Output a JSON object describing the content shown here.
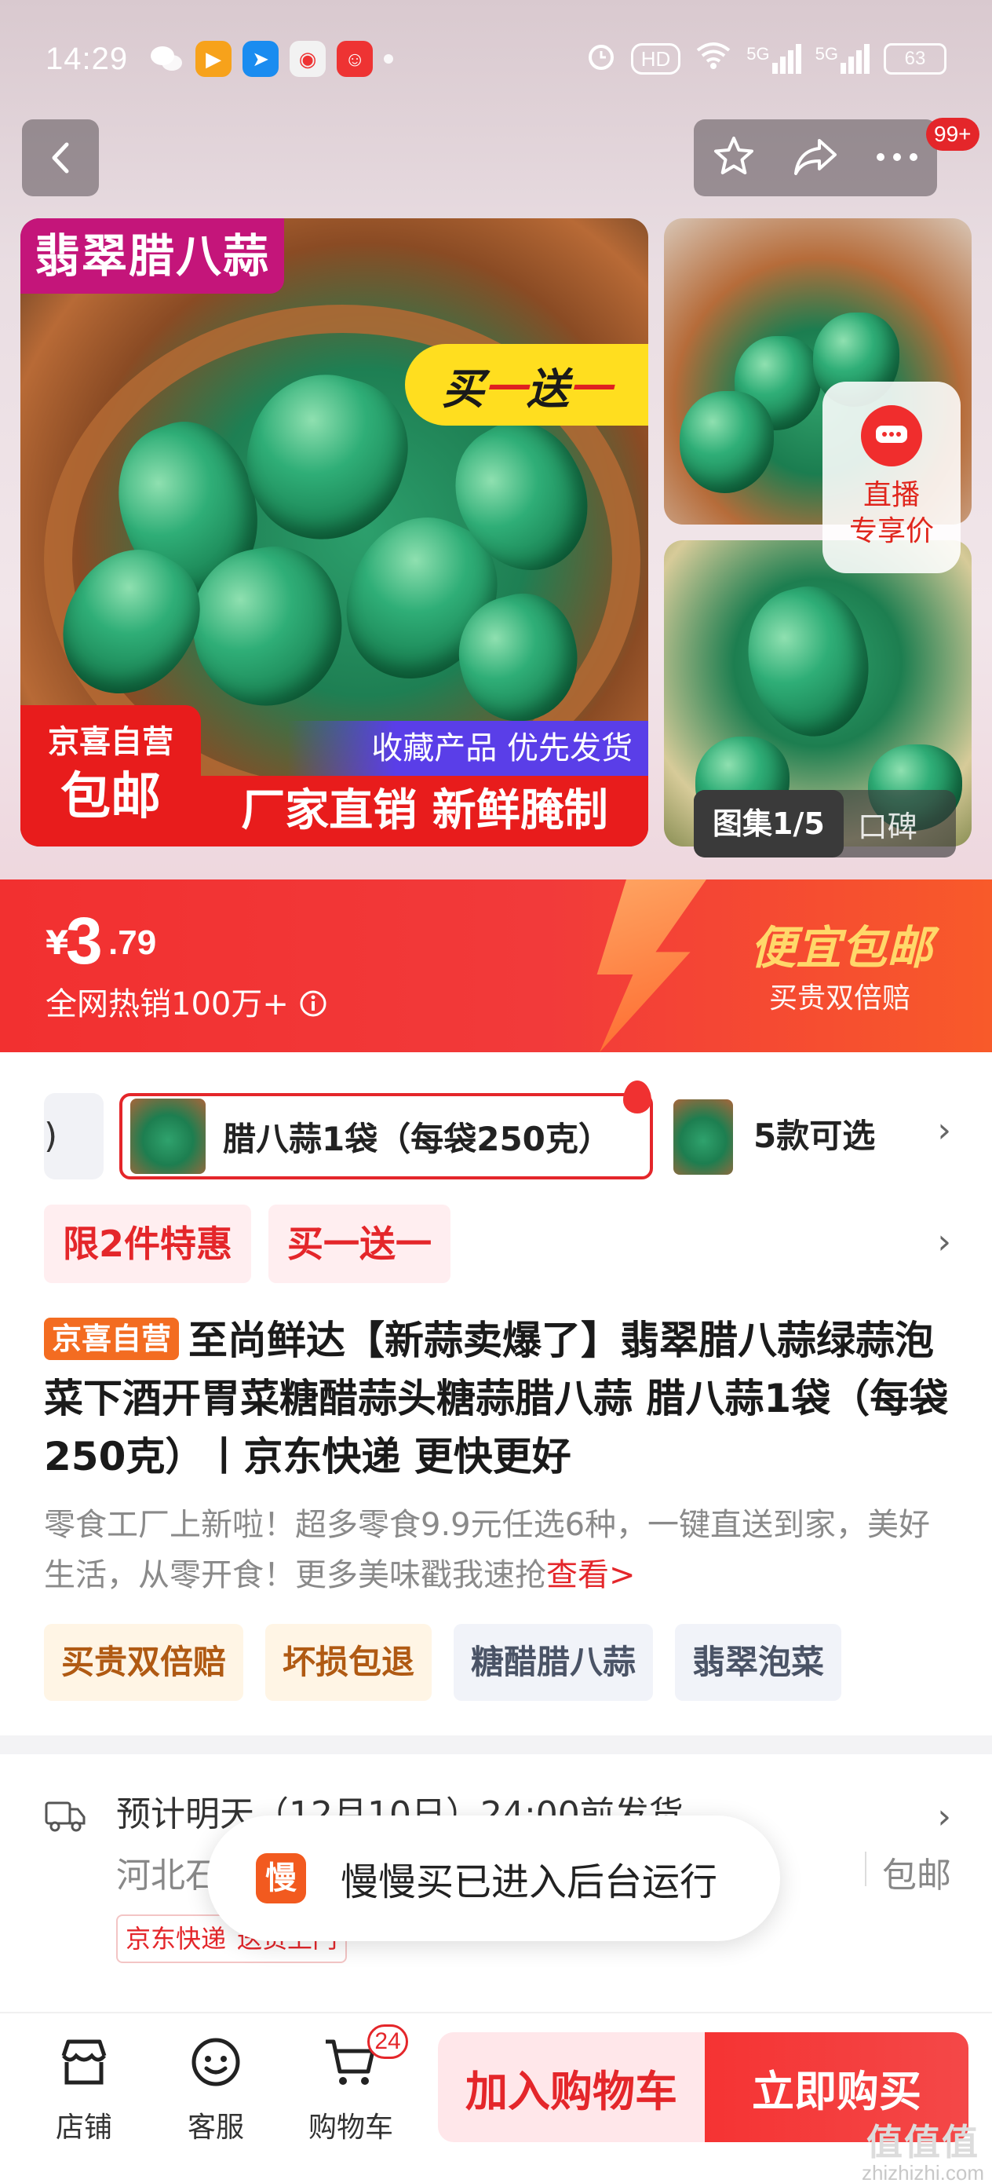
{
  "status_bar": {
    "time": "14:29",
    "hd_label": "HD",
    "signal_1": "5G",
    "signal_2": "5G",
    "battery": "63"
  },
  "nav": {
    "badge": "99+"
  },
  "gallery": {
    "main_title": "翡翠腊八蒜",
    "promo_left": "买",
    "promo_mid": "一",
    "promo_right": "送",
    "promo_end": "一",
    "fav_text": "收藏产品 优先发货",
    "bottom_text": "厂家直销 新鲜腌制",
    "self_badge_line1": "京喜自营",
    "self_badge_line2": "包邮",
    "live_line1": "直播",
    "live_line2": "专享价",
    "chip_active": "图集1/5",
    "chip_other": "口碑"
  },
  "price": {
    "currency": "¥",
    "integer": "3",
    "decimal": ".79",
    "hot_sales": "全网热销100万+",
    "cheap_label": "便宜包邮",
    "guarantee": "买贵双倍赔"
  },
  "variants": {
    "prev_fragment": ")",
    "selected_label": "腊八蒜1袋（每袋250克）",
    "count_label": "5款可选"
  },
  "promo_tags": [
    "限2件特惠",
    "买一送一"
  ],
  "product": {
    "self_tag": "京喜自营",
    "title": "至尚鲜达【新蒜卖爆了】翡翠腊八蒜绿蒜泡菜下酒开胃菜糖醋蒜头糖蒜腊八蒜 腊八蒜1袋（每袋250克）丨京东快递 更快更好",
    "description": "零食工厂上新啦！超多零食9.9元任选6种，一键直送到家，美好生活，从零开食！更多美味戳我速抢",
    "more_link": "查看>"
  },
  "feature_tags": [
    {
      "label": "买贵双倍赔",
      "tone": "warm"
    },
    {
      "label": "坏损包退",
      "tone": "warm"
    },
    {
      "label": "糖醋腊八蒜",
      "tone": "cool"
    },
    {
      "label": "翡翠泡菜",
      "tone": "cool"
    }
  ],
  "delivery": {
    "line1": "预计明天（12月10日）24:00前发货",
    "line2": "河北石家庄市…",
    "free_shipping": "包邮",
    "tag1": "京东快递",
    "tag2": "送货上门"
  },
  "toast": {
    "icon_char": "慢",
    "text": "慢慢买已进入后台运行"
  },
  "bottom_bar": {
    "shop": "店铺",
    "service": "客服",
    "cart": "购物车",
    "cart_count": "24",
    "add_to_cart": "加入购物车",
    "buy_now": "立即购买"
  },
  "watermark": {
    "line1": "值值值",
    "line2": "zhizhizhi.com"
  },
  "colors": {
    "accent_red": "#e4262a",
    "price_red": "#f23030",
    "self_orange": "#f36c21",
    "toast_icon": "#f25a1f"
  }
}
